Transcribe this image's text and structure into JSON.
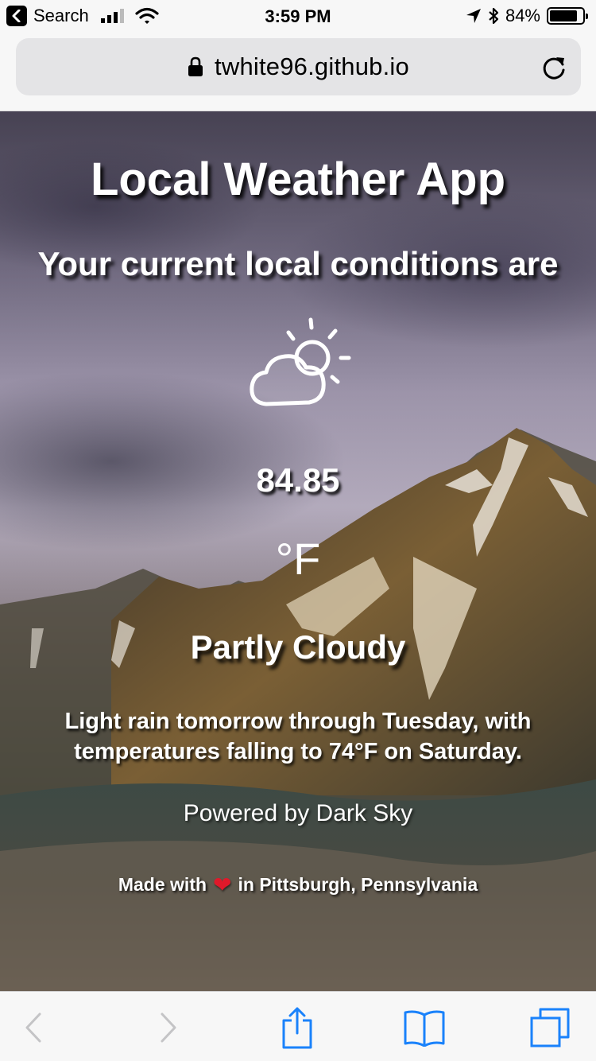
{
  "status_bar": {
    "back_label": "Search",
    "time": "3:59 PM",
    "battery_percent": "84%",
    "battery_level": 0.84
  },
  "browser": {
    "url": "twhite96.github.io"
  },
  "weather": {
    "title": "Local Weather App",
    "subtitle": "Your current local conditions are",
    "icon": "partly-cloudy-day-icon",
    "temperature": "84.85",
    "unit": "°F",
    "summary": "Partly Cloudy",
    "forecast": "Light rain tomorrow through Tuesday, with temperatures falling to 74°F on Saturday.",
    "powered_by": "Powered by Dark Sky",
    "credit_prefix": "Made with",
    "credit_suffix": "in Pittsburgh, Pennsylvania"
  },
  "toolbar": {
    "items": [
      "back-icon",
      "forward-icon",
      "share-icon",
      "bookmarks-icon",
      "tabs-icon"
    ]
  },
  "colors": {
    "accent": "#1a82fb",
    "heart": "#e0192a"
  }
}
